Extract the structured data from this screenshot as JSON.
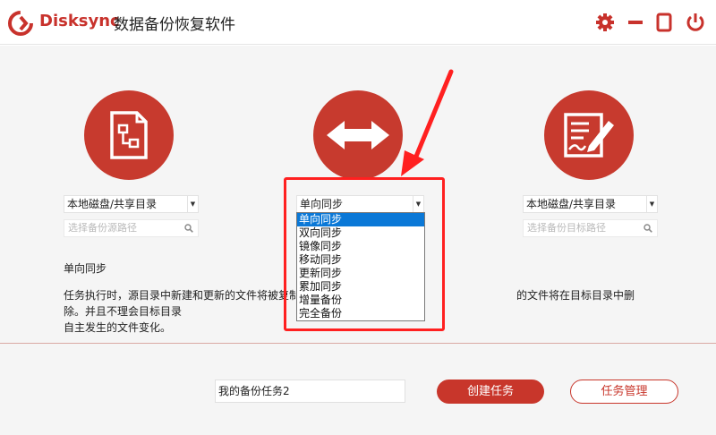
{
  "app": {
    "brand": "Disksync",
    "title": "数据备份恢复软件",
    "brand_color": "#c8322c"
  },
  "window_controls": {
    "icons": [
      "gear-icon",
      "minimize-icon",
      "maximize-icon",
      "power-icon"
    ]
  },
  "source": {
    "icon": "document-icon",
    "select_value": "本地磁盘/共享目录",
    "path_placeholder": "选择备份源路径"
  },
  "mode": {
    "icon": "double-arrow-icon",
    "select_value": "单向同步",
    "options": [
      "单向同步",
      "双向同步",
      "镜像同步",
      "移动同步",
      "更新同步",
      "累加同步",
      "增量备份",
      "完全备份"
    ],
    "selected_index": 0
  },
  "target": {
    "icon": "edit-form-icon",
    "select_value": "本地磁盘/共享目录",
    "path_placeholder": "选择备份目标路径"
  },
  "description": {
    "title": "单向同步",
    "line1_start": "任务执行时，源目录中新建和更新的文件将被复制到",
    "line1_end": "的文件将在目标目录中删除。并且不理会目标目录",
    "line2": "自主发生的文件变化。"
  },
  "footer": {
    "task_name": "我的备份任务2",
    "create_label": "创建任务",
    "manage_label": "任务管理"
  },
  "colors": {
    "accent": "#c73a2e",
    "highlight": "#ff2020",
    "selection": "#0a78d7"
  }
}
